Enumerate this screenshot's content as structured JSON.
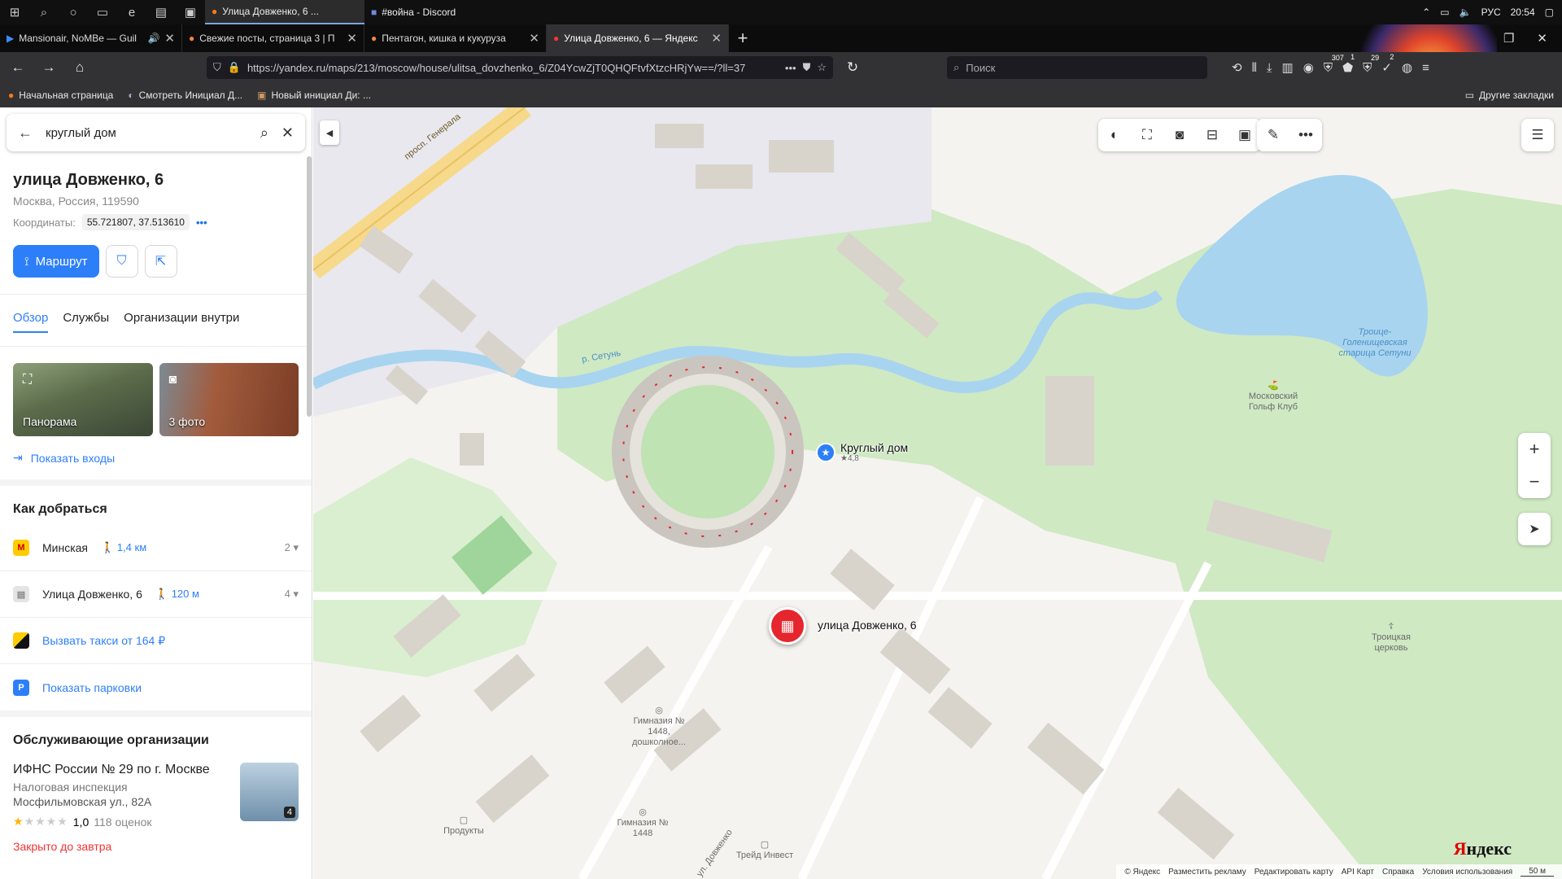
{
  "taskbar": {
    "windows": [
      {
        "title": "Улица Довженко, 6 ...",
        "active": true
      },
      {
        "title": "#война - Discord",
        "active": false
      }
    ],
    "lang": "РУС",
    "time": "20:54"
  },
  "tabs": [
    {
      "title": "Mansionair, NoMBe — Guil",
      "audio": true,
      "active": false
    },
    {
      "title": "Свежие посты, страница 3 | П",
      "active": false
    },
    {
      "title": "Пентагон, кишка и кукуруза",
      "active": false
    },
    {
      "title": "Улица Довженко, 6 — Яндекс",
      "active": true
    }
  ],
  "navbar": {
    "url": "https://yandex.ru/maps/213/moscow/house/ulitsa_dovzhenko_6/Z04YcwZjT0QHQFtvfXtzcHRjYw==/?ll=37",
    "search_placeholder": "Поиск",
    "badges": [
      "307",
      "1",
      "29",
      "2"
    ]
  },
  "bookmarks": {
    "items": [
      "Начальная страница",
      "Смотреть Инициал Д...",
      "Новый инициал Ди: ..."
    ],
    "other": "Другие закладки"
  },
  "sidebar": {
    "search_value": "круглый дом",
    "address_title": "улица Довженко, 6",
    "address_sub": "Москва, Россия, 119590",
    "coords_label": "Координаты:",
    "coords_value": "55.721807, 37.513610",
    "route_label": "Маршрут",
    "tabs": [
      "Обзор",
      "Службы",
      "Организации внутри"
    ],
    "photos": [
      {
        "label": "Панорама",
        "icon": "panorama-icon"
      },
      {
        "label": "3 фото",
        "icon": "camera-icon"
      }
    ],
    "show_entrances": "Показать входы",
    "howto_title": "Как добраться",
    "routes": [
      {
        "name": "Минская",
        "walk": "1,4 км",
        "count": "2",
        "type": "metro"
      },
      {
        "name": "Улица Довженко, 6",
        "walk": "120 м",
        "count": "4",
        "type": "bus"
      }
    ],
    "taxi": "Вызвать такси от 164 ₽",
    "parking": "Показать парковки",
    "orgs_title": "Обслуживающие организации",
    "org": {
      "name": "ИФНС России № 29 по г. Москве",
      "type": "Налоговая инспекция",
      "address": "Мосфильмовская ул., 82А",
      "rating": "1,0",
      "reviews": "118 оценок",
      "photo_count": "4",
      "status": "Закрыто до завтра"
    }
  },
  "map": {
    "labels": {
      "avenue": "просп. Генерала",
      "river": "р. Сетунь",
      "lake": "Троице-Голенищевская старица Сетуни",
      "golf": "Московский Гольф Клуб",
      "church": "Троицкая церковь",
      "school1": "Гимназия № 1448, дошколное...",
      "school2": "Гимназия № 1448",
      "products": "Продукты",
      "trade": "Трейд Инвест",
      "street": "ул. Довженко"
    },
    "poi_round": "Круглый дом",
    "poi_round_rating": "★4,8",
    "poi_address": "улица Довженко, 6",
    "logo_a": "Я",
    "logo_b": "ндекс",
    "scale": "50 м",
    "footer": [
      "© Яндекс",
      "Разместить рекламу",
      "Редактировать карту",
      "API Карт",
      "Справка",
      "Условия использования"
    ]
  }
}
